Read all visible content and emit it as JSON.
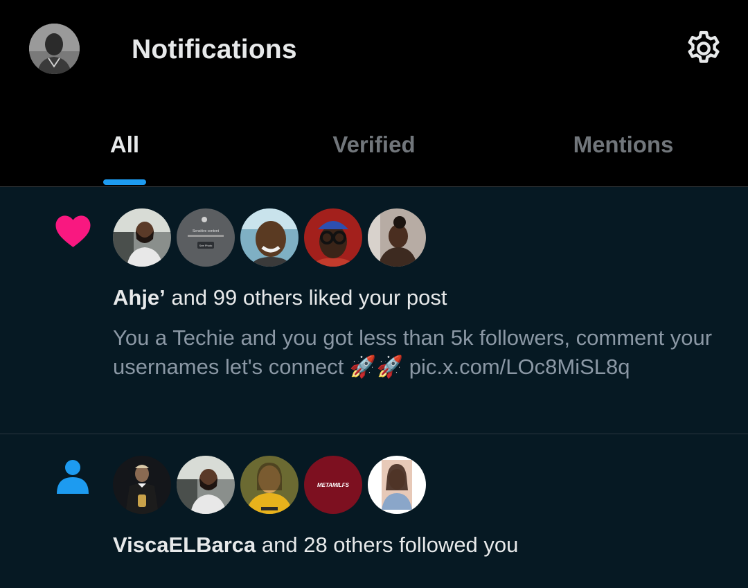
{
  "header": {
    "title": "Notifications",
    "settings_icon": "gear-icon",
    "profile_avatar_icon": "profile-avatar"
  },
  "tabs": [
    {
      "label": "All",
      "active": true
    },
    {
      "label": "Verified",
      "active": false
    },
    {
      "label": "Mentions",
      "active": false
    }
  ],
  "notifications": [
    {
      "type": "like",
      "icon": "heart-icon",
      "icon_color": "#f91880",
      "actor": "Ahje’",
      "action_text": " and 99 others liked your post",
      "body_text": "You a Techie and you got less than 5k followers, comment your usernames let's connect 🚀🚀",
      "body_link": "pic.x.com/LOc8MiSL8q",
      "avatars": [
        "avatar-man-car",
        "avatar-sensitive-content",
        "avatar-smiling-man",
        "avatar-man-glasses",
        "avatar-woman"
      ],
      "sensitive_label": "Sensitive content",
      "sensitive_button": "See Photo"
    },
    {
      "type": "follow",
      "icon": "person-icon",
      "icon_color": "#1d9bf0",
      "actor": "ViscaELBarca",
      "action_text": " and 28 others followed you",
      "avatars": [
        "avatar-man-trophy",
        "avatar-man-car",
        "avatar-mona-lisa",
        "avatar-metamilfs",
        "avatar-woman-selfie"
      ],
      "badge_text": "METAMILFS"
    }
  ],
  "colors": {
    "background": "#000000",
    "notification_bg": "#061923",
    "accent": "#1d9bf0",
    "like": "#f91880",
    "text_primary": "#e7e9ea",
    "text_secondary": "#8b98a5"
  }
}
